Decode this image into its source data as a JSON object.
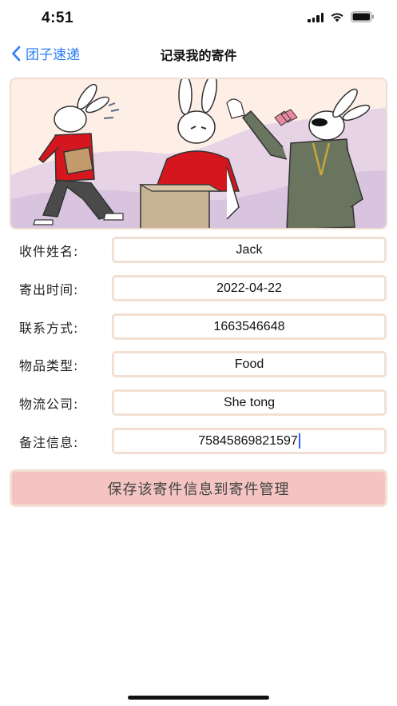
{
  "status_bar": {
    "time": "4:51"
  },
  "nav": {
    "back_label": "团子速递",
    "title": "记录我的寄件"
  },
  "form": {
    "fields": [
      {
        "label": "收件姓名:",
        "value": "Jack"
      },
      {
        "label": "寄出时间:",
        "value": "2022-04-22"
      },
      {
        "label": "联系方式:",
        "value": "1663546648"
      },
      {
        "label": "物品类型:",
        "value": "Food"
      },
      {
        "label": "物流公司:",
        "value": "She tong"
      },
      {
        "label": "备注信息:",
        "value": "75845869821597"
      }
    ],
    "save_label": "保存该寄件信息到寄件管理"
  },
  "colors": {
    "accent": "#2c7cf6",
    "button_bg": "#f3c4c2",
    "field_border": "#f1e0d3",
    "banner_bg": "#fdeee6",
    "banner_wave": "#d9c4e0",
    "shirt_red": "#d5161e"
  }
}
